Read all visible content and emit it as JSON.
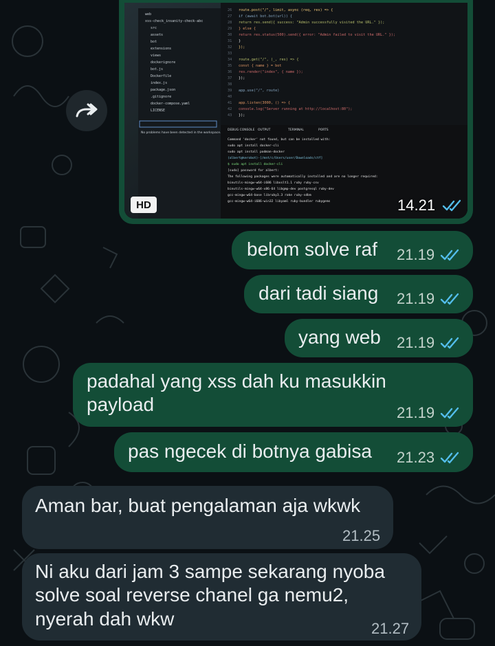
{
  "image_message": {
    "hd_label": "HD",
    "time": "14.21"
  },
  "screenshot_content": {
    "file_tree": [
      "web",
      "xss-check_insanity-check-abc",
      "src",
      "assets",
      "bot",
      "extensions",
      "views",
      "dockerignore",
      "bot.js",
      "Dockerfile",
      "index.js",
      "package.json",
      ".gitignore",
      "docker-compose.yaml",
      "LICENSE"
    ],
    "code_lines": [
      "route.post(\"/\", limit, async (req, res) => {",
      "  if (await bot.bot(url)) {",
      "    return res.send({ success: \"Admin successfully visited the URL.\" });",
      "  } else {",
      "    return res.status(500).send({ error: \"Admin failed to visit the URL.\" });",
      "  }",
      "});",
      "",
      "route.get(\"/\", (_, res) => {",
      "  const { name } = bot",
      "  res.render(\"index\", { name });",
      "});",
      "",
      "app.use(\"/\", route)",
      "",
      "app.listen(3000, () => {",
      "  console.log(\"Server running at http://localhost:80\");",
      "});"
    ],
    "panel_tabs": [
      "DEBUG CONSOLE",
      "OUTPUT",
      "TERMINAL",
      "PORTS"
    ],
    "problems_text": "No problems have been detected in the workspace.",
    "terminal_lines": [
      "Command 'docker' not found, but can be installed with:",
      "sudo apt install docker-cli",
      "sudo apt install podman-docker",
      "(albert@kerobot)-[/mnt/c/Users/user/Downloads/ctf]",
      "$ sudo apt install docker-cli",
      "[sudo] password for albert:",
      "The following packages were automatically installed and are no longer required:",
      "binutils-mingw-w64-i686   libxslt1.1   ruby   ruby-csv",
      "binutils-mingw-w64-x86-64 libgmp-dev  postgresql  ruby-dev",
      "gcc-mingw-w64-base        libruby3.3  rake   ruby-sdbm",
      "gcc-mingw-w64-i686-win32  libyaml    ruby-bundler  rubygems"
    ]
  },
  "messages": [
    {
      "text": "belom solve raf",
      "time": "21.19"
    },
    {
      "text": "dari tadi siang",
      "time": "21.19"
    },
    {
      "text": "yang web",
      "time": "21.19"
    },
    {
      "line1": "padahal yang xss dah ku masukkin",
      "line2": "payload",
      "time": "21.19"
    },
    {
      "text": "pas ngecek di botnya gabisa",
      "time": "21.23"
    },
    {
      "text": "Aman bar, buat pengalaman aja wkwk",
      "time": "21.25"
    },
    {
      "line1": "Ni aku dari jam 3 sampe sekarang nyoba",
      "line2": "solve soal reverse chanel ga nemu2,",
      "line3": "nyerah dah wkw",
      "time": "21.27"
    }
  ],
  "colors": {
    "background": "#0b1014",
    "outgoing_bubble": "#134d37",
    "incoming_bubble": "#202c33",
    "read_tick": "#53bdeb"
  },
  "icons": [
    "forward-icon",
    "double-check-icon",
    "hd-badge"
  ]
}
